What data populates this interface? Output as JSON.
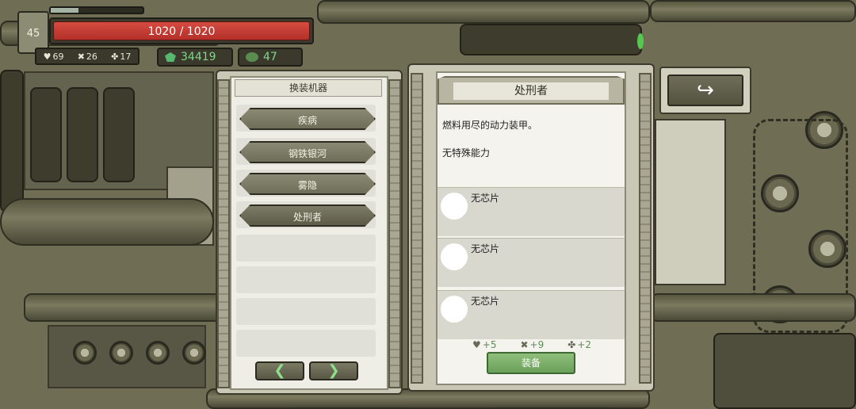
{
  "hud": {
    "level": "45",
    "hp_text": "1020 / 1020",
    "xp_fraction": 0.3,
    "stats": {
      "hearts": "69",
      "attack": "26",
      "luck": "17"
    },
    "currency": {
      "gems": "34419",
      "ore": "47"
    }
  },
  "machine_list": {
    "title": "换装机器",
    "items": [
      {
        "label": "疾病"
      },
      {
        "label": "钢铁银河"
      },
      {
        "label": "雾隐"
      },
      {
        "label": "处刑者"
      }
    ],
    "prev_label": "❮",
    "next_label": "❯"
  },
  "detail": {
    "name": "处刑者",
    "description": "燃料用尽的动力装甲。",
    "ability": "无特殊能力",
    "chips": [
      {
        "label": "无芯片"
      },
      {
        "label": "无芯片"
      },
      {
        "label": "无芯片"
      }
    ],
    "bonus": {
      "hearts": "+5",
      "attack": "+9",
      "luck": "+2"
    },
    "equip_label": "装备"
  },
  "back_button": {
    "icon": "return-arrow-icon",
    "label": "↪"
  },
  "colors": {
    "hp": "#c0392b",
    "accent_green": "#7fd88a",
    "panel": "#efeee6"
  }
}
